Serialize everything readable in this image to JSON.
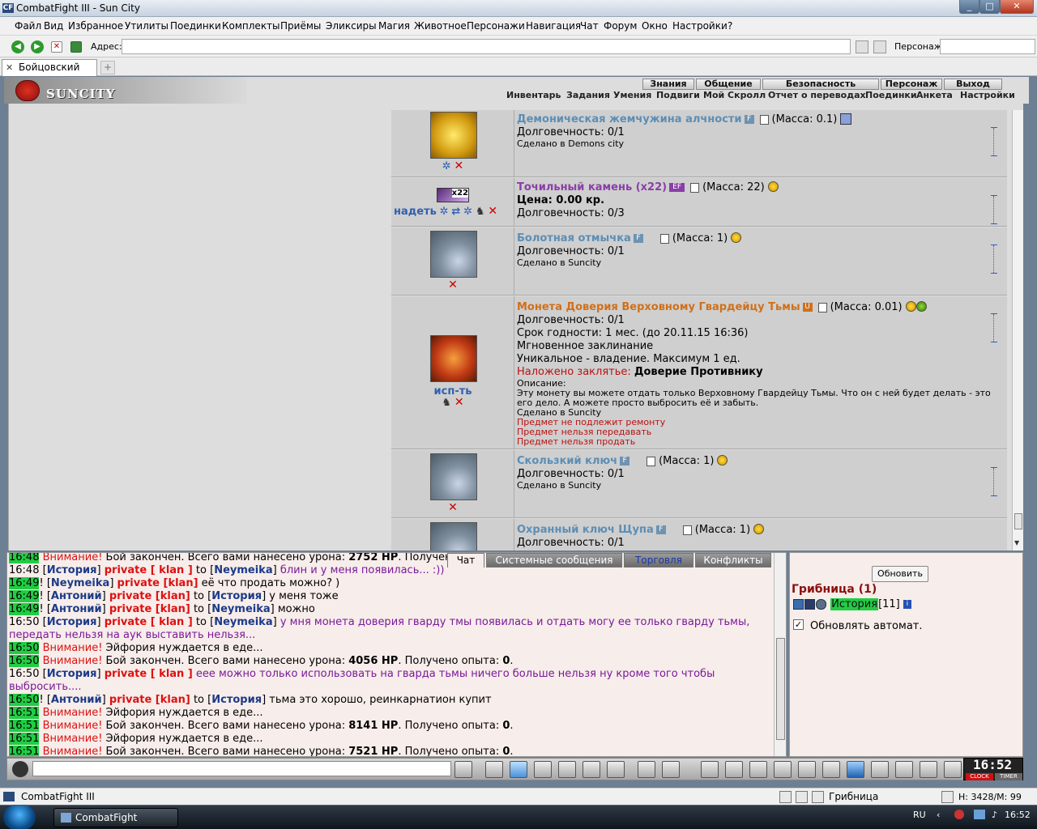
{
  "window": {
    "title": "CombatFight III - Sun City",
    "min": "_",
    "max": "□",
    "close": "✕",
    "icon": "CF"
  },
  "menu": [
    "Файл",
    "Вид",
    "Избранное",
    "Утилиты",
    "Поединки",
    "Комплекты",
    "Приёмы",
    "Эликсиры",
    "Магия",
    "Животное",
    "Персонажи",
    "Навигация",
    "Чат",
    "Форум",
    "Окно",
    "Настройки",
    "?"
  ],
  "address": {
    "label": "Адрес:",
    "value": "",
    "persona_label": "Персонаж:",
    "persona_value": ""
  },
  "tabs": [
    {
      "label": "Бойцовский клуб"
    }
  ],
  "game": {
    "logo": "SUNCITY",
    "top_tabs": [
      "Знания",
      "Общение",
      "Безопасность",
      "Персонаж",
      "Выход"
    ],
    "subnav": [
      "Инвентарь",
      "Задания",
      "Умения",
      "Подвиги",
      "Мой Скролл",
      "Отчет о переводах",
      "Поединки",
      "Анкета",
      "Настройки"
    ]
  },
  "items": [
    {
      "name": "Демоническая жемчужина алчности",
      "badge": "F",
      "mass": "(Масса: 0.1)",
      "lines": [
        "Долговечность: 0/1"
      ],
      "made": "Сделано в Demons city",
      "img": "coin"
    },
    {
      "name": "Точильный камень (x22)",
      "badge": "EF",
      "mass": "(Масса: 22)",
      "price": "Цена: 0.00 кр.",
      "lines": [
        "Долговечность: 0/3"
      ],
      "action": "надеть",
      "count": "x22"
    },
    {
      "name": "Болотная отмычка",
      "badge": "F",
      "mass": "(Масса: 1)",
      "lines": [
        "Долговечность: 0/1"
      ],
      "made": "Сделано в Suncity",
      "img": "key"
    },
    {
      "name": "Монета Доверия Верховному Гвардейцу Тьмы",
      "badge": "U",
      "mass": "(Масса: 0.01)",
      "lines": [
        "Долговечность: 0/1",
        "Срок годности: 1 мес. (до 20.11.15 16:36)",
        "Мгновенное заклинание",
        "Уникальное - владение. Максимум 1 ед."
      ],
      "spell_label": "Наложено заклятье:",
      "spell_value": "Доверие Противнику",
      "desc_label": "Описание:",
      "desc": "Эту монету вы можете отдать только Верховному Гвардейцу Тьмы. Что он с ней будет делать - это его дело. А можете просто выбросить её и забыть.",
      "made": "Сделано в Suncity",
      "notes": [
        "Предмет не подлежит ремонту",
        "Предмет нельзя передавать",
        "Предмет нельзя продать"
      ],
      "action": "исп-ть",
      "img": "med"
    },
    {
      "name": "Скользкий ключ",
      "badge": "F",
      "mass": "(Масса: 1)",
      "lines": [
        "Долговечность: 0/1"
      ],
      "made": "Сделано в Suncity",
      "img": "key"
    },
    {
      "name": "Охранный ключ Щупа",
      "badge": "F",
      "mass": "(Масса: 1)",
      "lines": [
        "Долговечность: 0/1"
      ],
      "img": "key"
    }
  ],
  "chat": {
    "tabs": [
      "Чат",
      "Системные сообщения",
      "Торговля",
      "Конфликты"
    ],
    "msg1": {
      "time": "16:48",
      "warn": "Внимание!",
      "pre": " Бой закончен. Всего вами нанесено урона: ",
      "val": "2752 HP",
      "post": ". Получен"
    },
    "msg2": {
      "time": "16:48",
      "name": "История",
      "priv": "private [ klan ]",
      "to": " to ",
      "target": "Neymeika",
      "text": " блин и у меня появилась... :))"
    },
    "msg3": {
      "time": "16:49",
      "name": "Neymeika",
      "priv": "private [klan]",
      "text": " её что продать можно? )"
    },
    "msg4": {
      "time": "16:49",
      "name": "Антоний",
      "priv": "private [klan]",
      "to": " to ",
      "target": "История",
      "text": " у меня тоже"
    },
    "msg5": {
      "time": "16:49",
      "name": "Антоний",
      "priv": "private [klan]",
      "to": " to ",
      "target": "Neymeika",
      "text": " можно"
    },
    "msg6": {
      "time": "16:50",
      "name": "История",
      "priv": "private [ klan ]",
      "to": " to ",
      "target": "Neymeika",
      "text": " у мня монета доверия гварду тмы появилась и отдать могу ее только гварду тьмы,",
      "text2": "передать нельзя на аук выставить нельзя..."
    },
    "msg7": {
      "time": "16:50",
      "warn": "Внимание!",
      "text": " Эйфория нуждается в еде..."
    },
    "msg8": {
      "time": "16:50",
      "warn": "Внимание!",
      "pre": " Бой закончен. Всего вами нанесено урона: ",
      "val": "4056 HP",
      "mid": ". Получено опыта: ",
      "exp": "0",
      "post": "."
    },
    "msg9": {
      "time": "16:50",
      "name": "История",
      "priv": "private [ klan ]",
      "text": " еее можно только использовать на гварда тьмы ничего больше нельзя ну кроме того чтобы",
      "text2": "выбросить...."
    },
    "msg10": {
      "time": "16:50",
      "name": "Антоний",
      "priv": "private [klan]",
      "to": " to ",
      "target": "История",
      "text": " тьма это хорошо, реинкарнатион купит"
    },
    "msg11": {
      "time": "16:51",
      "warn": "Внимание!",
      "text": " Эйфория нуждается в еде..."
    },
    "msg12": {
      "time": "16:51",
      "warn": "Внимание!",
      "pre": " Бой закончен. Всего вами нанесено урона: ",
      "val": "8141 HP",
      "mid": ". Получено опыта: ",
      "exp": "0",
      "post": "."
    },
    "msg13": {
      "time": "16:51",
      "warn": "Внимание!",
      "text": " Эйфория нуждается в еде..."
    },
    "msg14": {
      "time": "16:51",
      "warn": "Внимание!",
      "pre": " Бой закончен. Всего вами нанесено урона: ",
      "val": "7521 HP",
      "mid": ". Получено опыта: ",
      "exp": "0",
      "post": "."
    }
  },
  "panel": {
    "refresh": "Обновить",
    "location": "Грибница (1)",
    "user": "История",
    "level": "[11]",
    "info": "i",
    "auto_label": "Обновлять автомат.",
    "auto_check": "✓"
  },
  "clock": {
    "time": "16:52",
    "clock": "CLOCK",
    "timer": "TIMER"
  },
  "status": {
    "app": "CombatFight III",
    "location": "Грибница",
    "hm": "H: 3428/M: 99"
  },
  "taskbar": {
    "app": "CombatFight",
    "lang": "RU",
    "time": "16:52"
  }
}
